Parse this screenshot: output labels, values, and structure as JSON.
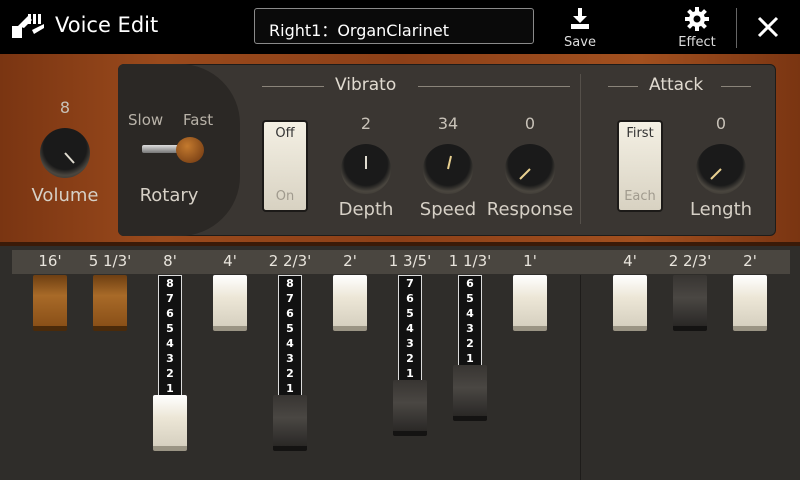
{
  "header": {
    "title": "Voice Edit",
    "voice_name": "Right1：OrganClarinet",
    "save_label": "Save",
    "effect_label": "Effect",
    "close_icon": "close-icon"
  },
  "controls": {
    "volume": {
      "label": "Volume",
      "value": "8"
    },
    "rotary": {
      "label": "Rotary",
      "slow": "Slow",
      "fast": "Fast"
    },
    "vibrato": {
      "title": "Vibrato",
      "toggle_on": "On",
      "toggle_off": "Off",
      "depth": {
        "label": "Depth",
        "value": "2"
      },
      "speed": {
        "label": "Speed",
        "value": "34"
      },
      "response": {
        "label": "Response",
        "value": "0"
      }
    },
    "attack": {
      "title": "Attack",
      "toggle_first": "First",
      "toggle_each": "Each",
      "length": {
        "label": "Length",
        "value": "0"
      }
    }
  },
  "drawbars": [
    {
      "footage": "16'",
      "color": "brown",
      "level": 0
    },
    {
      "footage": "5 1/3'",
      "color": "brown",
      "level": 0
    },
    {
      "footage": "8'",
      "color": "white",
      "level": 8,
      "numbers": [
        "8",
        "7",
        "6",
        "5",
        "4",
        "3",
        "2",
        "1"
      ]
    },
    {
      "footage": "4'",
      "color": "white",
      "level": 0
    },
    {
      "footage": "2 2/3'",
      "color": "black",
      "level": 8,
      "numbers": [
        "8",
        "7",
        "6",
        "5",
        "4",
        "3",
        "2",
        "1"
      ]
    },
    {
      "footage": "2'",
      "color": "white",
      "level": 0
    },
    {
      "footage": "1 3/5'",
      "color": "black",
      "level": 7,
      "numbers": [
        "7",
        "6",
        "5",
        "4",
        "3",
        "2",
        "1"
      ]
    },
    {
      "footage": "1 1/3'",
      "color": "black",
      "level": 6,
      "numbers": [
        "6",
        "5",
        "4",
        "3",
        "2",
        "1"
      ]
    },
    {
      "footage": "1'",
      "color": "white",
      "level": 0
    },
    {
      "footage": "4'",
      "color": "white",
      "level": 0
    },
    {
      "footage": "2 2/3'",
      "color": "black",
      "level": 0
    },
    {
      "footage": "2'",
      "color": "white",
      "level": 0
    }
  ]
}
